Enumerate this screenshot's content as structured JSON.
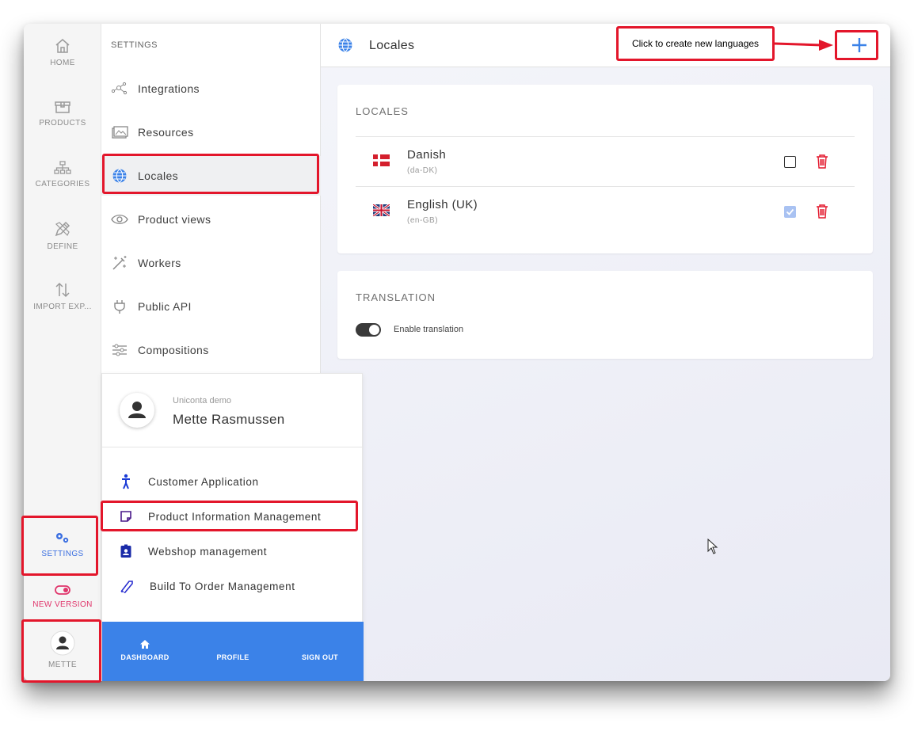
{
  "rail": {
    "items": [
      {
        "label": "HOME",
        "icon": "home-icon"
      },
      {
        "label": "PRODUCTS",
        "icon": "box-icon"
      },
      {
        "label": "CATEGORIES",
        "icon": "sitemap-icon"
      },
      {
        "label": "DEFINE",
        "icon": "pencil-ruler-icon"
      },
      {
        "label": "IMPORT EXP...",
        "icon": "arrows-updown-icon"
      }
    ],
    "settings_label": "SETTINGS",
    "new_version_label": "NEW VERSION",
    "user_label": "METTE"
  },
  "settings_menu": {
    "heading": "SETTINGS",
    "items": [
      {
        "label": "Integrations",
        "icon": "integrations-icon"
      },
      {
        "label": "Resources",
        "icon": "images-icon"
      },
      {
        "label": "Locales",
        "icon": "globe-icon"
      },
      {
        "label": "Product views",
        "icon": "eye-icon"
      },
      {
        "label": "Workers",
        "icon": "magic-wand-icon"
      },
      {
        "label": "Public API",
        "icon": "plug-icon"
      },
      {
        "label": "Compositions",
        "icon": "sliders-icon"
      }
    ]
  },
  "header": {
    "title": "Locales"
  },
  "locales_card": {
    "title": "LOCALES",
    "rows": [
      {
        "name": "Danish",
        "code": "(da-DK)",
        "checked": false
      },
      {
        "name": "English (UK)",
        "code": "(en-GB)",
        "checked": true
      }
    ]
  },
  "translation_card": {
    "title": "TRANSLATION",
    "toggle_label": "Enable translation"
  },
  "profile_popup": {
    "org": "Uniconta demo",
    "user": "Mette Rasmussen",
    "apps": [
      {
        "label": "Customer Application"
      },
      {
        "label": "Product Information Management"
      },
      {
        "label": "Webshop management"
      },
      {
        "label": "Build To Order Management"
      }
    ],
    "footer": {
      "dashboard": "DASHBOARD",
      "profile": "PROFILE",
      "signout": "SIGN OUT"
    }
  },
  "annotation": {
    "callout_text": "Click to create new languages"
  },
  "colors": {
    "accent": "#3b82e8",
    "danger": "#e3162b",
    "settings_active": "#3b6fe0",
    "new_version": "#e0356b"
  }
}
